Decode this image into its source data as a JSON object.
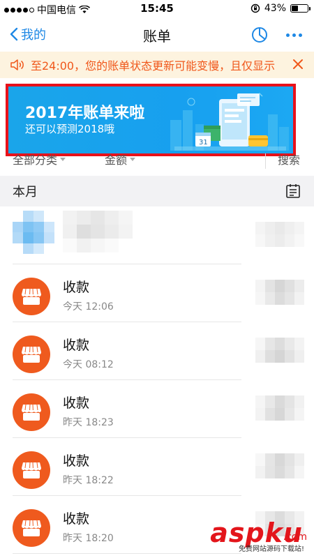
{
  "status": {
    "carrier": "中国电信",
    "time": "15:45",
    "battery": "43%",
    "battery_level": 0.43
  },
  "nav": {
    "back_label": "我的",
    "title": "账单"
  },
  "notice": {
    "text": "至24:00，您的账单状态更新可能变慢，且仅显示"
  },
  "banner": {
    "title": "2017年账单来啦",
    "subtitle": "还可以预测2018哦",
    "calendar_day": "31"
  },
  "filters": {
    "category": "全部分类",
    "amount": "金额",
    "search": "搜索"
  },
  "section": {
    "title": "本月"
  },
  "transactions": [
    {
      "title": "收款",
      "time": "今天  12:06"
    },
    {
      "title": "收款",
      "time": "今天  08:12"
    },
    {
      "title": "收款",
      "time": "昨天  18:23"
    },
    {
      "title": "收款",
      "time": "昨天  18:22"
    },
    {
      "title": "收款",
      "time": "昨天  18:20"
    }
  ],
  "watermark": {
    "main": "aspku",
    "domain": ".com",
    "sub": "免费网站源码下载站!"
  },
  "colors": {
    "accent": "#1e88e5",
    "notice_bg": "#fdf3df",
    "notice_text": "#f0571a",
    "banner_bg": "#1aa5ea",
    "highlight_border": "#e8111a",
    "avatar": "#ef5a1e"
  }
}
